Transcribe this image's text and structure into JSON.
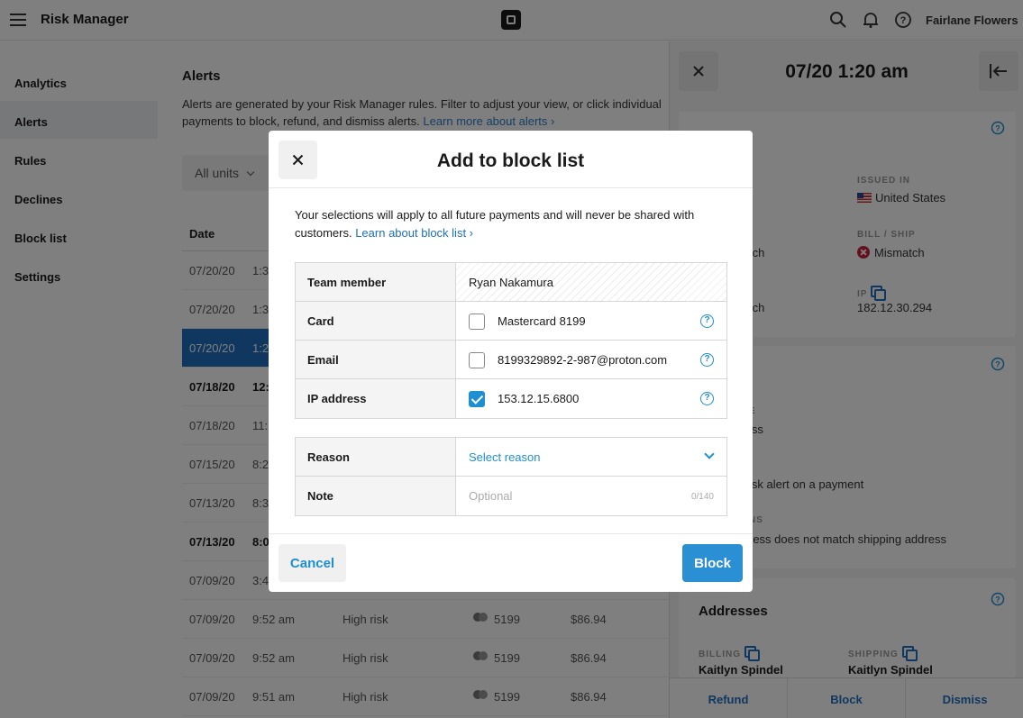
{
  "app": {
    "title": "Risk Manager",
    "merchant": "Fairlane Flowers"
  },
  "sidebar": {
    "items": [
      {
        "label": "Analytics"
      },
      {
        "label": "Alerts"
      },
      {
        "label": "Rules"
      },
      {
        "label": "Declines"
      },
      {
        "label": "Block list"
      },
      {
        "label": "Settings"
      }
    ]
  },
  "main": {
    "heading": "Alerts",
    "description": "Alerts are generated by your Risk Manager rules. Filter to adjust your view, or click individual payments to block, refund, and dismiss alerts.",
    "learn_more": "Learn more about alerts ›",
    "filter_label": "All units",
    "col_date": "Date",
    "rows": [
      {
        "date": "07/20/20",
        "time": "1:3",
        "risk": "",
        "last4": "",
        "amount": ""
      },
      {
        "date": "07/20/20",
        "time": "1:3",
        "risk": "",
        "last4": "",
        "amount": ""
      },
      {
        "date": "07/20/20",
        "time": "1:2",
        "risk": "",
        "last4": "",
        "amount": ""
      },
      {
        "date": "07/18/20",
        "time": "12:",
        "risk": "",
        "last4": "",
        "amount": ""
      },
      {
        "date": "07/18/20",
        "time": "11:",
        "risk": "",
        "last4": "",
        "amount": ""
      },
      {
        "date": "07/15/20",
        "time": "8:2",
        "risk": "",
        "last4": "",
        "amount": ""
      },
      {
        "date": "07/13/20",
        "time": "8:3",
        "risk": "",
        "last4": "",
        "amount": ""
      },
      {
        "date": "07/13/20",
        "time": "8:0",
        "risk": "",
        "last4": "",
        "amount": ""
      },
      {
        "date": "07/09/20",
        "time": "3:4",
        "risk": "",
        "last4": "",
        "amount": ""
      },
      {
        "date": "07/09/20",
        "time": "9:52 am",
        "risk": "High risk",
        "last4": "5199",
        "amount": "$86.94"
      },
      {
        "date": "07/09/20",
        "time": "9:52 am",
        "risk": "High risk",
        "last4": "5199",
        "amount": "$86.94"
      },
      {
        "date": "07/09/20",
        "time": "9:51 am",
        "risk": "High risk",
        "last4": "5199",
        "amount": "$86.94"
      }
    ]
  },
  "panel": {
    "title": "07/20 1:20 am",
    "issued_in_label": "ISSUED IN",
    "issued_in_value": "United States",
    "bill_ship_label": "BILL / SHIP",
    "bill_ship_value": "Mismatch",
    "partial_match_1": "tch",
    "ip_label": "IP",
    "ip_value": "182.12.30.294",
    "partial_match_2": "tch",
    "partial_e": "E",
    "partial_iss": "iss",
    "partial_alert": "isk alert on a payment",
    "partial_ns": "NS",
    "partial_address": "ress does not match shipping address",
    "addresses_heading": "Addresses",
    "billing_label": "BILLING",
    "billing_name": "Kaitlyn Spindel",
    "shipping_label": "SHIPPING",
    "shipping_name": "Kaitlyn Spindel",
    "actions": {
      "refund": "Refund",
      "block": "Block",
      "dismiss": "Dismiss"
    }
  },
  "modal": {
    "title": "Add to block list",
    "intro": "Your selections will apply to all future payments and will never be shared with customers.",
    "intro_link": "Learn about block list ›",
    "team_member_label": "Team member",
    "team_member_value": "Ryan Nakamura",
    "card_label": "Card",
    "card_value": "Mastercard 8199",
    "card_checked": false,
    "email_label": "Email",
    "email_value": "8199329892-2-987@proton.com",
    "email_checked": false,
    "ip_label": "IP address",
    "ip_value": "153.12.15.6800",
    "ip_checked": true,
    "reason_label": "Reason",
    "reason_value": "Select reason",
    "note_label": "Note",
    "note_placeholder": "Optional",
    "note_counter": "0/140",
    "cancel": "Cancel",
    "block": "Block"
  },
  "colors": {
    "accent": "#1e8fd0",
    "selected_row": "#1e6fbf",
    "mismatch": "#c8223a"
  }
}
